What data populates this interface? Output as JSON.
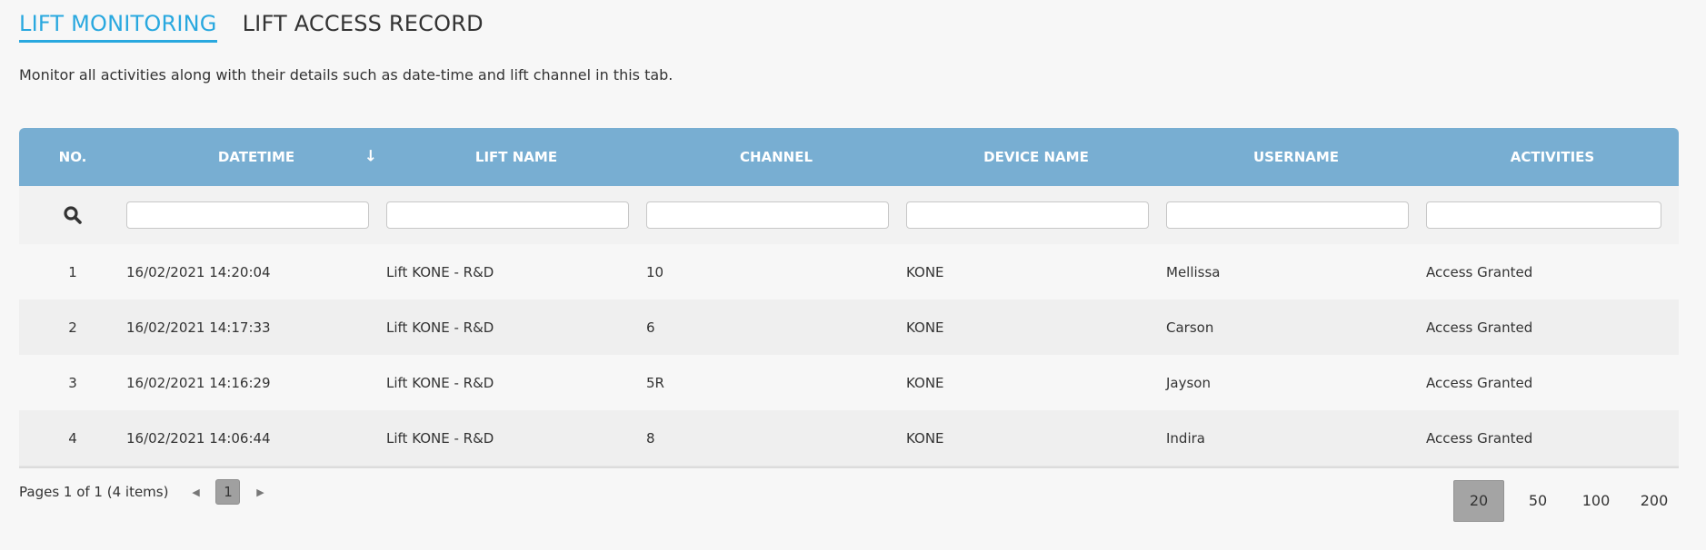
{
  "tabs": [
    {
      "label": "LIFT MONITORING",
      "active": true
    },
    {
      "label": "LIFT ACCESS RECORD",
      "active": false
    }
  ],
  "description": "Monitor all activities along with their details such as date-time and lift channel in this tab.",
  "table": {
    "columns": [
      "NO.",
      "DATETIME",
      "LIFT NAME",
      "CHANNEL",
      "DEVICE NAME",
      "USERNAME",
      "ACTIVITIES"
    ],
    "sort_icon": "arrow-down-icon",
    "filter_icon": "search-icon",
    "filters": [
      "",
      "",
      "",
      "",
      "",
      ""
    ],
    "rows": [
      [
        "1",
        "16/02/2021 14:20:04",
        "Lift KONE - R&D",
        "10",
        "KONE",
        "Mellissa",
        "Access Granted"
      ],
      [
        "2",
        "16/02/2021 14:17:33",
        "Lift KONE - R&D",
        "6",
        "KONE",
        "Carson",
        "Access Granted"
      ],
      [
        "3",
        "16/02/2021 14:16:29",
        "Lift KONE - R&D",
        "5R",
        "KONE",
        "Jayson",
        "Access Granted"
      ],
      [
        "4",
        "16/02/2021 14:06:44",
        "Lift KONE - R&D",
        "8",
        "KONE",
        "Indira",
        "Access Granted"
      ]
    ]
  },
  "pager": {
    "info": "Pages 1 of 1 (4 items)",
    "current_page": "1",
    "page_sizes": [
      "20",
      "50",
      "100",
      "200"
    ],
    "selected_page_size": "20"
  },
  "colors": {
    "accent": "#29a8df",
    "header_bg": "#78aed2"
  }
}
